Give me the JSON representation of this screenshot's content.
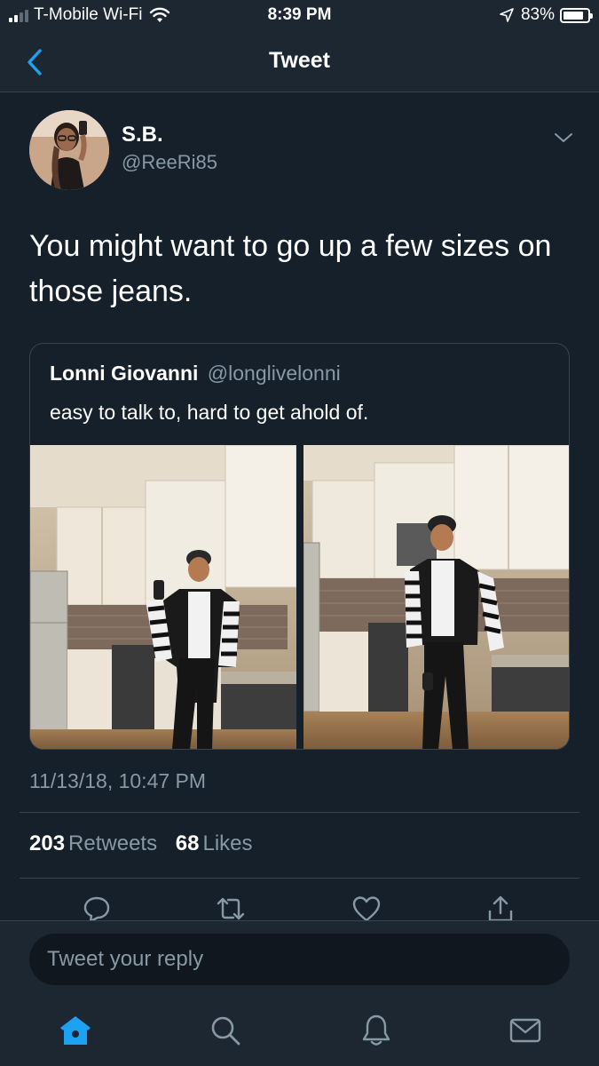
{
  "status_bar": {
    "carrier": "T-Mobile Wi-Fi",
    "time": "8:39 PM",
    "battery": "83%",
    "battery_level": 0.83,
    "signal_bars": 2,
    "icons": [
      "signal-icon",
      "wifi-icon",
      "location-arrow-icon",
      "battery-icon"
    ]
  },
  "header": {
    "title": "Tweet",
    "back_icon": "chevron-left-icon"
  },
  "tweet": {
    "author_name": "S.B.",
    "author_handle": "@ReeRi85",
    "text": "You might want to go up a few sizes on those jeans.",
    "timestamp": "11/13/18, 10:47 PM",
    "retweets_count": "203",
    "retweets_label": "Retweets",
    "likes_count": "68",
    "likes_label": "Likes",
    "menu_icon": "chevron-down-icon"
  },
  "quote": {
    "author_name": "Lonni Giovanni",
    "author_handle": "@longlivelonni",
    "text": "easy to talk to, hard to get ahold of.",
    "photos": [
      "kitchen-photo-left",
      "kitchen-photo-right"
    ]
  },
  "actions": [
    "reply-icon",
    "retweet-icon",
    "like-icon",
    "share-icon"
  ],
  "reply": {
    "placeholder": "Tweet your reply"
  },
  "tabs": [
    "home-icon",
    "search-icon",
    "notifications-icon",
    "messages-icon"
  ],
  "colors": {
    "background": "#15202b",
    "bar": "#1c2732",
    "accent": "#1da1f2",
    "secondary_text": "#8899a6",
    "border": "#38444d"
  }
}
